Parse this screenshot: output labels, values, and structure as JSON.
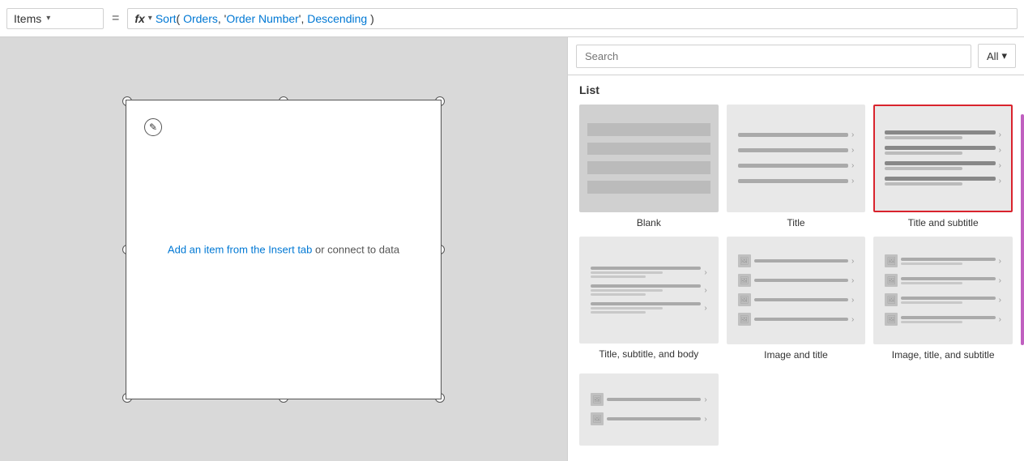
{
  "topbar": {
    "items_label": "Items",
    "chevron": "▾",
    "equals": "=",
    "fx_label": "fx",
    "formula": "Sort( Orders, 'Order Number', Descending )"
  },
  "canvas": {
    "message_link": "Add an item from the Insert tab",
    "message_normal": " or connect to data"
  },
  "panel": {
    "search_placeholder": "Search",
    "all_label": "All",
    "section_label": "List",
    "layouts": [
      {
        "id": "blank",
        "label": "Blank",
        "type": "blank",
        "selected": false
      },
      {
        "id": "title",
        "label": "Title",
        "type": "title",
        "selected": false
      },
      {
        "id": "title-subtitle",
        "label": "Title and subtitle",
        "type": "title-subtitle",
        "selected": true
      },
      {
        "id": "title-subtitle-body",
        "label": "Title, subtitle, and body",
        "type": "image-title-subtitle",
        "selected": false
      },
      {
        "id": "image-title",
        "label": "Image and title",
        "type": "image-title",
        "selected": false
      },
      {
        "id": "image-title-subtitle",
        "label": "Image, title, and subtitle",
        "type": "image-title-subtitle2",
        "selected": false
      }
    ]
  }
}
